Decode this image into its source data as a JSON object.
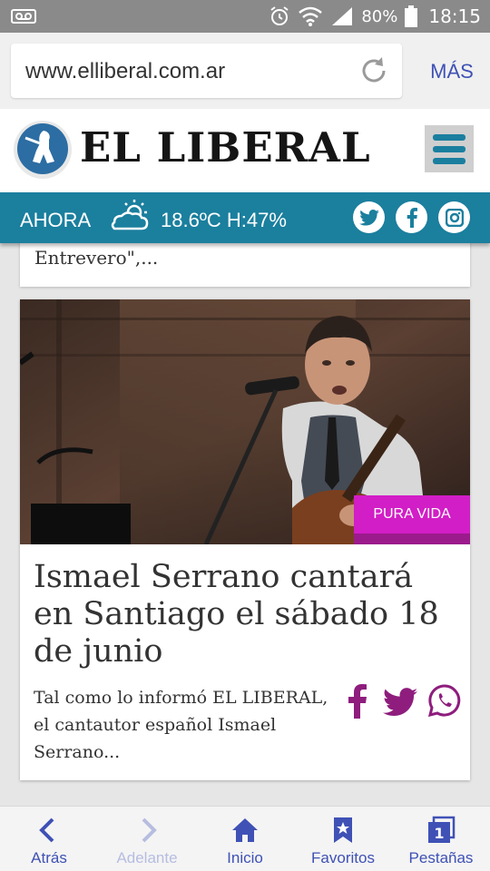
{
  "status_bar": {
    "battery": "80%",
    "time": "18:15",
    "icons": [
      "voicemail-icon",
      "alarm-icon",
      "wifi-icon",
      "signal-icon",
      "battery-icon"
    ]
  },
  "browser": {
    "url": "www.elliberal.com.ar",
    "more_label": "MÁS"
  },
  "site": {
    "logo_text": "EL LIBERAL",
    "weather": {
      "label": "AHORA",
      "reading": "18.6ºC H:47%"
    },
    "accent_color": "#1b7f9e"
  },
  "previous_article": {
    "text": "Entrevero\",..."
  },
  "article": {
    "section": "PURA VIDA",
    "section_color": "#d21ec6",
    "headline": "Ismael Serrano cantará en Santiago el sábado 18 de junio",
    "summary": "Tal como lo informó EL LIBERAL, el cantautor español Ismael Serrano..."
  },
  "bottom_nav": {
    "items": [
      {
        "label": "Atrás",
        "icon": "back-arrow-icon"
      },
      {
        "label": "Adelante",
        "icon": "forward-arrow-icon"
      },
      {
        "label": "Inicio",
        "icon": "home-icon"
      },
      {
        "label": "Favoritos",
        "icon": "bookmark-icon"
      },
      {
        "label": "Pestañas",
        "icon": "tabs-icon",
        "count": "1"
      }
    ]
  }
}
